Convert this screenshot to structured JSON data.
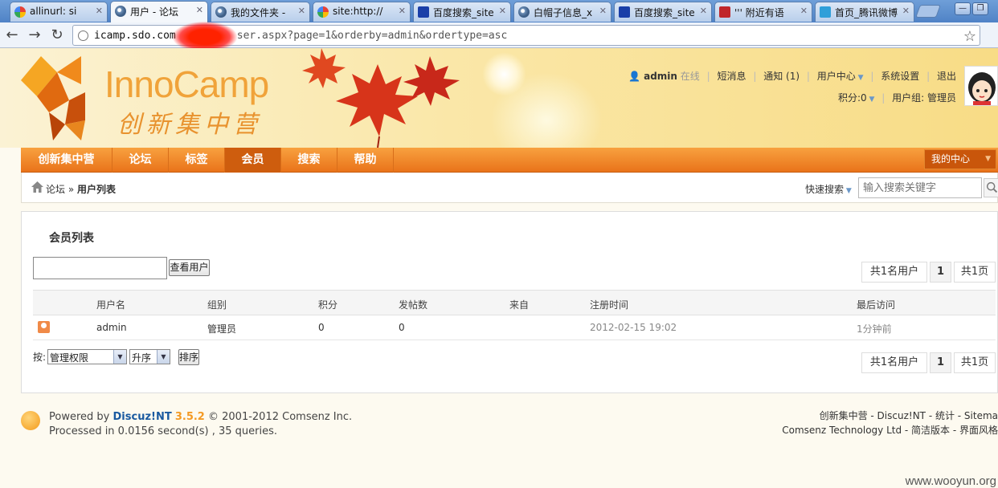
{
  "browser": {
    "tabs": [
      {
        "title": "allinurl: si",
        "icon": "google-icon"
      },
      {
        "title": "用户 - 论坛",
        "icon": "globe-icon"
      },
      {
        "title": "我的文件夹 -",
        "icon": "globe-icon"
      },
      {
        "title": "site:http://",
        "icon": "google-icon"
      },
      {
        "title": "百度搜索_site",
        "icon": "baidu-paw-icon"
      },
      {
        "title": "白帽子信息_x",
        "icon": "globe-icon"
      },
      {
        "title": "百度搜索_site",
        "icon": "baidu-paw-icon"
      },
      {
        "title": "''' 附近有语",
        "icon": "yahoo-icon"
      },
      {
        "title": "首页_腾讯微博",
        "icon": "qq-icon"
      }
    ],
    "url_host": "icamp.sdo.com",
    "url_rest": "ser.aspx?page=1&orderby=admin&ordertype=asc"
  },
  "header": {
    "brand": "InnoCamp",
    "brand_cn": "创新集中营",
    "user": {
      "name": "admin",
      "status": "在线",
      "links": [
        "短消息",
        "通知 (1)",
        "用户中心",
        "系统设置",
        "退出"
      ],
      "points": "积分:0",
      "group": "用户组: 管理员"
    }
  },
  "nav": {
    "items": [
      "创新集中营",
      "论坛",
      "标签",
      "会员",
      "搜索",
      "帮助"
    ],
    "current": "会员",
    "my_center": "我的中心"
  },
  "breadcrumb": {
    "home": "论坛",
    "sep": "»",
    "current": "用户列表",
    "quick_search_label": "快速搜索",
    "search_placeholder": "输入搜索关键字"
  },
  "main": {
    "title": "会员列表",
    "view_user_button": "查看用户",
    "pager": {
      "total_users": "共1名用户",
      "page": "1",
      "total_pages": "共1页"
    },
    "columns": [
      "用户名",
      "组别",
      "积分",
      "发帖数",
      "来自",
      "注册时间",
      "最后访问"
    ],
    "rows": [
      {
        "username": "admin",
        "group": "管理员",
        "points": "0",
        "posts": "0",
        "from": "",
        "registered": "2012-02-15 19:02",
        "last_visit": "1分钟前"
      }
    ],
    "sort": {
      "label": "按:",
      "field": "管理权限",
      "order": "升序",
      "button": "排序"
    }
  },
  "footer": {
    "powered_by": "Powered by",
    "product": "Discuz!NT",
    "version": "3.5.2",
    "copyright": "© 2001-2012 Comsenz Inc.",
    "processed": "Processed in 0.0156 second(s) , 35 queries.",
    "right_line1": "创新集中营 - Discuz!NT - 统计 - Sitema",
    "right_line2": "Comsenz Technology Ltd - 简洁版本 - 界面风格"
  },
  "watermark": "www.wooyun.org"
}
